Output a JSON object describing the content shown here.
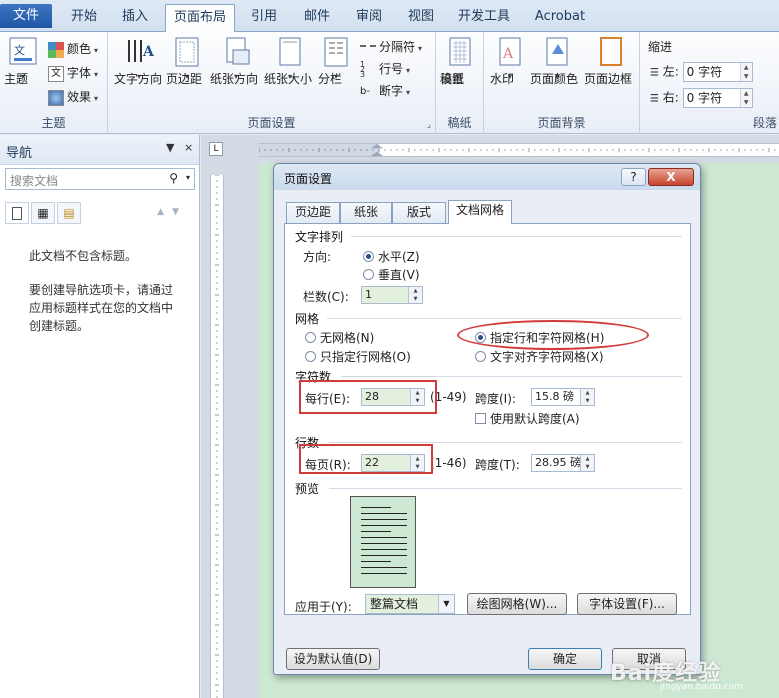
{
  "tabs": [
    "文件",
    "开始",
    "插入",
    "页面布局",
    "引用",
    "邮件",
    "审阅",
    "视图",
    "开发工具",
    "Acrobat"
  ],
  "ribbon": {
    "theme_group": {
      "label": "主题",
      "themes_btn": "主题",
      "colors": "颜色",
      "fonts": "字体",
      "effects": "效果"
    },
    "page_setup_group": {
      "label": "页面设置",
      "text_direction": "文字方向",
      "margins": "页边距",
      "orientation": "纸张方向",
      "size": "纸张大小",
      "columns": "分栏",
      "breaks": "分隔符",
      "line_numbers": "行号",
      "hyphenation": "断字"
    },
    "draft_group": {
      "label": "稿纸",
      "draft_settings_1": "稿纸",
      "draft_settings_2": "设置"
    },
    "background_group": {
      "label": "页面背景",
      "watermark": "水印",
      "page_color": "页面颜色",
      "page_borders": "页面边框"
    },
    "paragraph_group": {
      "label": "段落",
      "indent": "缩进",
      "left_label": "左:",
      "left_value": "0 字符",
      "right_label": "右:",
      "right_value": "0 字符"
    }
  },
  "nav": {
    "title": "导航",
    "search_placeholder": "搜索文档",
    "msg1": "此文档不包含标题。",
    "msg2_l1": "要创建导航选项卡，请通过",
    "msg2_l2": "应用标题样式在您的文档中",
    "msg2_l3": "创建标题。"
  },
  "dialog": {
    "title": "页面设置",
    "help": "?",
    "close": "X",
    "tabs": [
      "页边距",
      "纸张",
      "版式",
      "文档网格"
    ],
    "text_layout": {
      "label": "文字排列",
      "direction_label": "方向:",
      "horizontal": "水平(Z)",
      "vertical": "垂直(V)",
      "columns_label": "栏数(C):",
      "columns_value": "1"
    },
    "grid": {
      "label": "网格",
      "no_grid": "无网格(N)",
      "line_grid_only": "只指定行网格(O)",
      "line_char_grid": "指定行和字符网格(H)",
      "snap_char_grid": "文字对齐字符网格(X)"
    },
    "characters": {
      "label": "字符数",
      "per_line_label": "每行(E):",
      "per_line_value": "28",
      "per_line_range": "(1-49)",
      "pitch_label": "跨度(I):",
      "pitch_value": "15.8 磅",
      "use_default": "使用默认跨度(A)"
    },
    "lines": {
      "label": "行数",
      "per_page_label": "每页(R):",
      "per_page_value": "22",
      "per_page_range": "(1-46)",
      "pitch_label": "跨度(T):",
      "pitch_value": "28.95 磅"
    },
    "preview_label": "预览",
    "apply_to_label": "应用于(Y):",
    "apply_to_value": "整篇文档",
    "draw_grid_btn": "绘图网格(W)...",
    "font_settings_btn": "字体设置(F)...",
    "set_default_btn": "设为默认值(D)",
    "ok_btn": "确定",
    "cancel_btn": "取消"
  },
  "watermark": {
    "text": "Bai度经验",
    "sub": "jingyan.baidu.com"
  }
}
